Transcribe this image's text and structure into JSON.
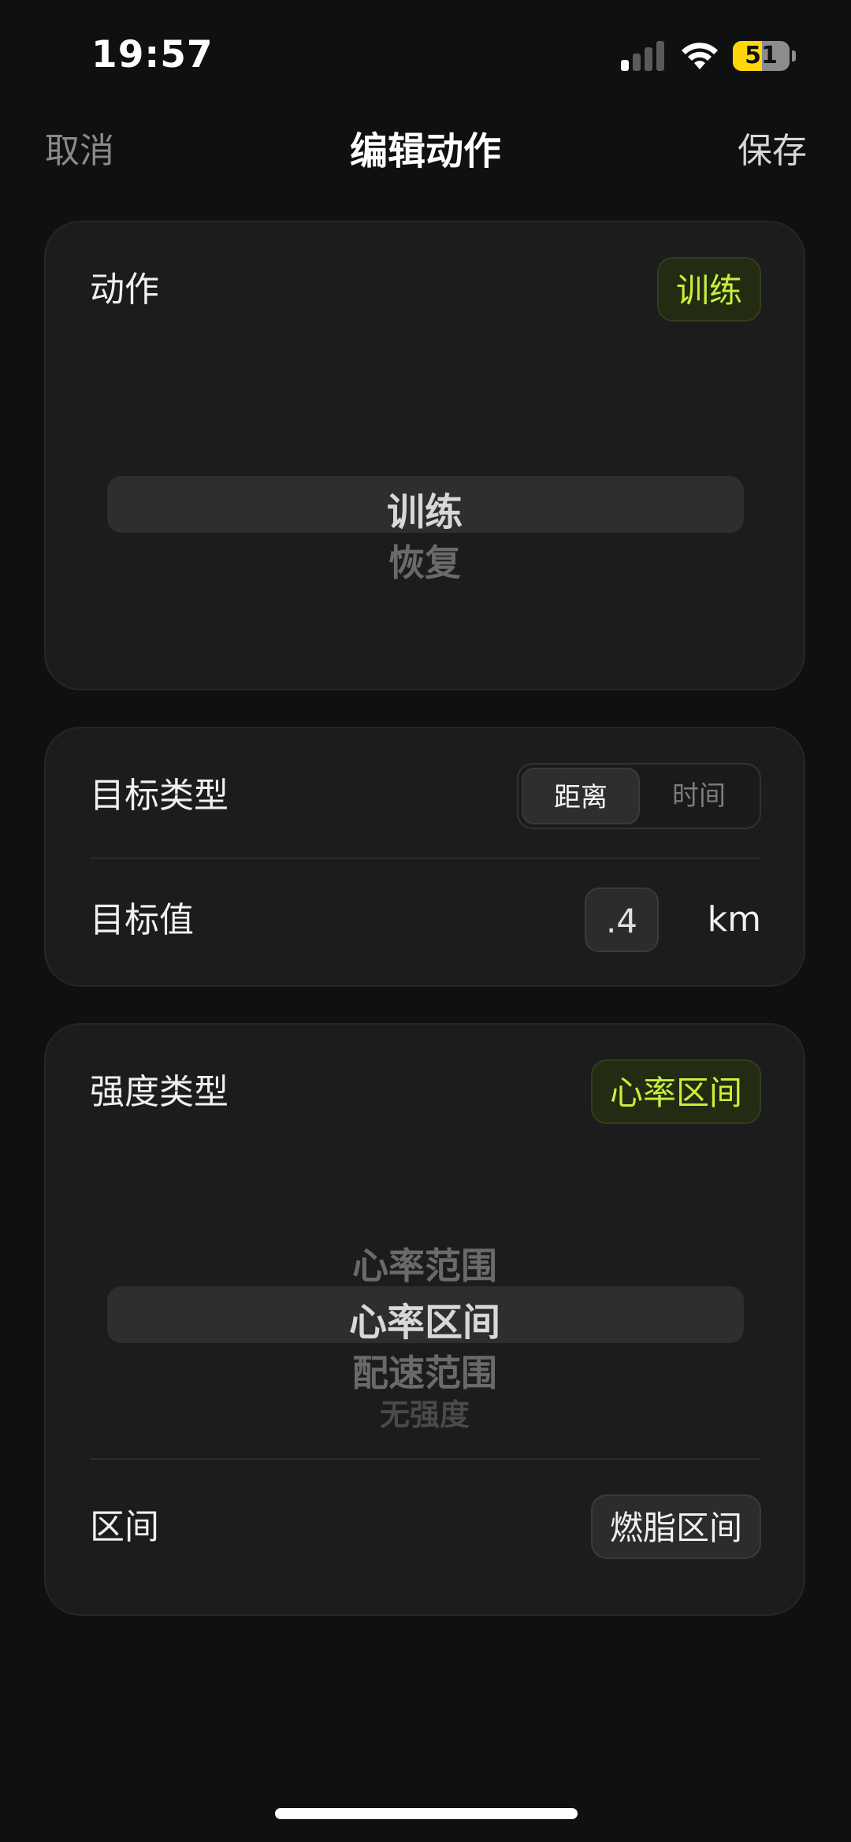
{
  "status_bar": {
    "time": "19:57",
    "signal_bars_active": 1,
    "signal_bars_total": 4,
    "battery_level": "51",
    "battery_fraction": 0.51,
    "battery_color": "#ffd60a"
  },
  "nav": {
    "cancel_label": "取消",
    "title": "编辑动作",
    "save_label": "保存"
  },
  "action_card": {
    "label": "动作",
    "selected_value": "训练",
    "picker_options": [
      "训练",
      "恢复"
    ],
    "picker_selected_index": 0
  },
  "target_card": {
    "type_label": "目标类型",
    "type_options": [
      "距离",
      "时间"
    ],
    "type_selected_index": 0,
    "value_label": "目标值",
    "value": ".4",
    "unit": "km"
  },
  "intensity_card": {
    "label": "强度类型",
    "selected_value": "心率区间",
    "picker_options": [
      "心率范围",
      "心率区间",
      "配速范围",
      "无强度"
    ],
    "picker_selected_index": 1,
    "zone_label": "区间",
    "zone_value": "燃脂区间"
  },
  "colors": {
    "accent": "#c6f03b",
    "background": "#101010",
    "card": "#1c1c1c"
  }
}
